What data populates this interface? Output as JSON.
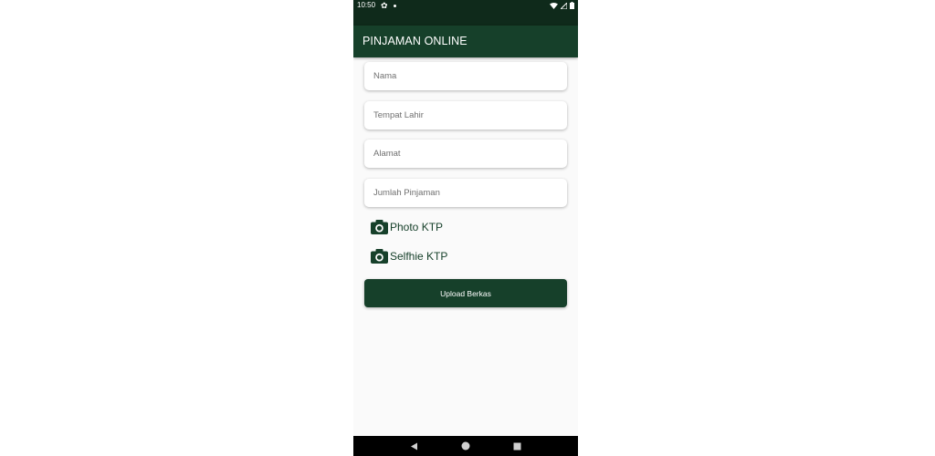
{
  "status_bar": {
    "time": "10:50",
    "icons": [
      "gear-icon",
      "notification-dot-icon",
      "wifi-icon",
      "signal-icon",
      "battery-icon"
    ]
  },
  "toolbar": {
    "title": "PINJAMAN ONLINE"
  },
  "form": {
    "fields": [
      {
        "placeholder": "Nama",
        "value": ""
      },
      {
        "placeholder": "Tempat Lahir",
        "value": ""
      },
      {
        "placeholder": "Alamat",
        "value": ""
      },
      {
        "placeholder": "Jumlah Pinjaman",
        "value": ""
      }
    ],
    "photo_ktp_label": "Photo KTP",
    "selfie_ktp_label": "Selfhie KTP",
    "upload_label": "Upload Berkas"
  },
  "nav_bar": {
    "icons": [
      "back-icon",
      "home-icon",
      "recents-icon"
    ]
  },
  "colors": {
    "primary": "#16402a",
    "primary_dark": "#0f2a1b",
    "background": "#fafafa"
  }
}
